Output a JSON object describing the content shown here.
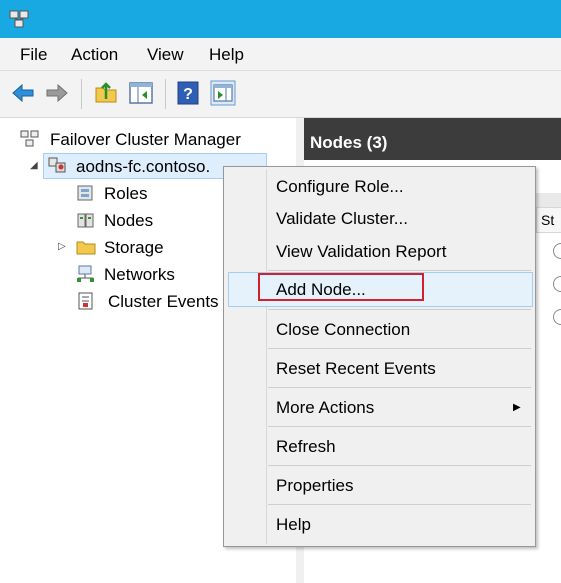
{
  "menubar": {
    "items": [
      "File",
      "Action",
      "View",
      "Help"
    ]
  },
  "toolbar": {
    "buttons": [
      "back-icon",
      "forward-icon",
      "up-folder-icon",
      "show-hide-console-tree-icon",
      "help-icon",
      "show-hide-action-pane-icon"
    ]
  },
  "tree": {
    "root": "Failover Cluster Manager",
    "cluster": "aodns-fc.contoso.",
    "children": [
      "Roles",
      "Nodes",
      "Storage",
      "Networks",
      "Cluster Events"
    ]
  },
  "right_pane": {
    "header": "Nodes (3)",
    "column_header_fragment": "St"
  },
  "context_menu": {
    "items": [
      "Configure Role...",
      "Validate Cluster...",
      "View Validation Report",
      "Add Node...",
      "Close Connection",
      "Reset Recent Events",
      "More Actions",
      "Refresh",
      "Properties",
      "Help"
    ],
    "highlighted_item": "Add Node..."
  },
  "colors": {
    "titlebar": "#19a9e2",
    "header_dark": "#3c3c3c",
    "highlight_border": "#d3212c",
    "hover_bg": "#e5f1fb"
  }
}
